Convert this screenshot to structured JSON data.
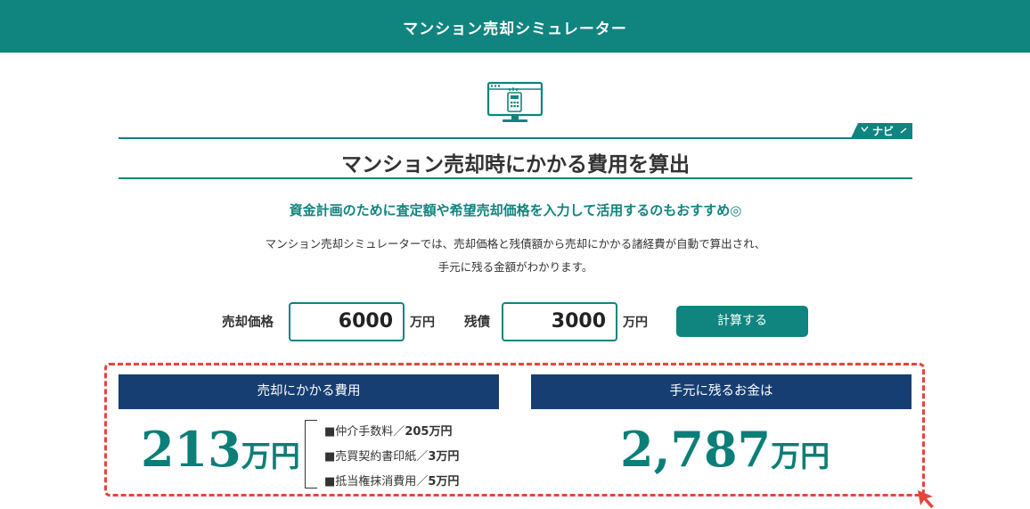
{
  "header": {
    "title": "マンション売却シミュレーター"
  },
  "navi_badge": "ナビ",
  "heading": "マンション売却時にかかる費用を算出",
  "subtitle": "資金計画のために査定額や希望売却価格を入力して活用するのもおすすめ◎",
  "description": [
    "マンション売却シミュレーターでは、売却価格と残債額から売却にかかる諸経費が自動で算出され、",
    "手元に残る金額がわかります。"
  ],
  "form": {
    "price_label": "売却価格",
    "price_value": "6000",
    "price_unit": "万円",
    "debt_label": "残債",
    "debt_value": "3000",
    "debt_unit": "万円",
    "calc_button": "計算する"
  },
  "results": {
    "cost_header": "売却にかかる費用",
    "cost_amount": "213",
    "cost_unit": "万円",
    "breakdown": [
      {
        "bullet": "■",
        "label": "仲介手数料／",
        "value": "205万円"
      },
      {
        "bullet": "■",
        "label": "売買契約書印紙／",
        "value": "3万円"
      },
      {
        "bullet": "■",
        "label": "抵当権抹消費用／",
        "value": "5万円"
      }
    ],
    "remaining_header": "手元に残るお金は",
    "remaining_amount": "2,787",
    "remaining_unit": "万円"
  },
  "colors": {
    "teal": "#10847e",
    "navy": "#163e72",
    "highlight": "#e2473d"
  },
  "icons": [
    "calculator-monitor-icon",
    "pencil-icon",
    "cursor-arrow-icon"
  ]
}
